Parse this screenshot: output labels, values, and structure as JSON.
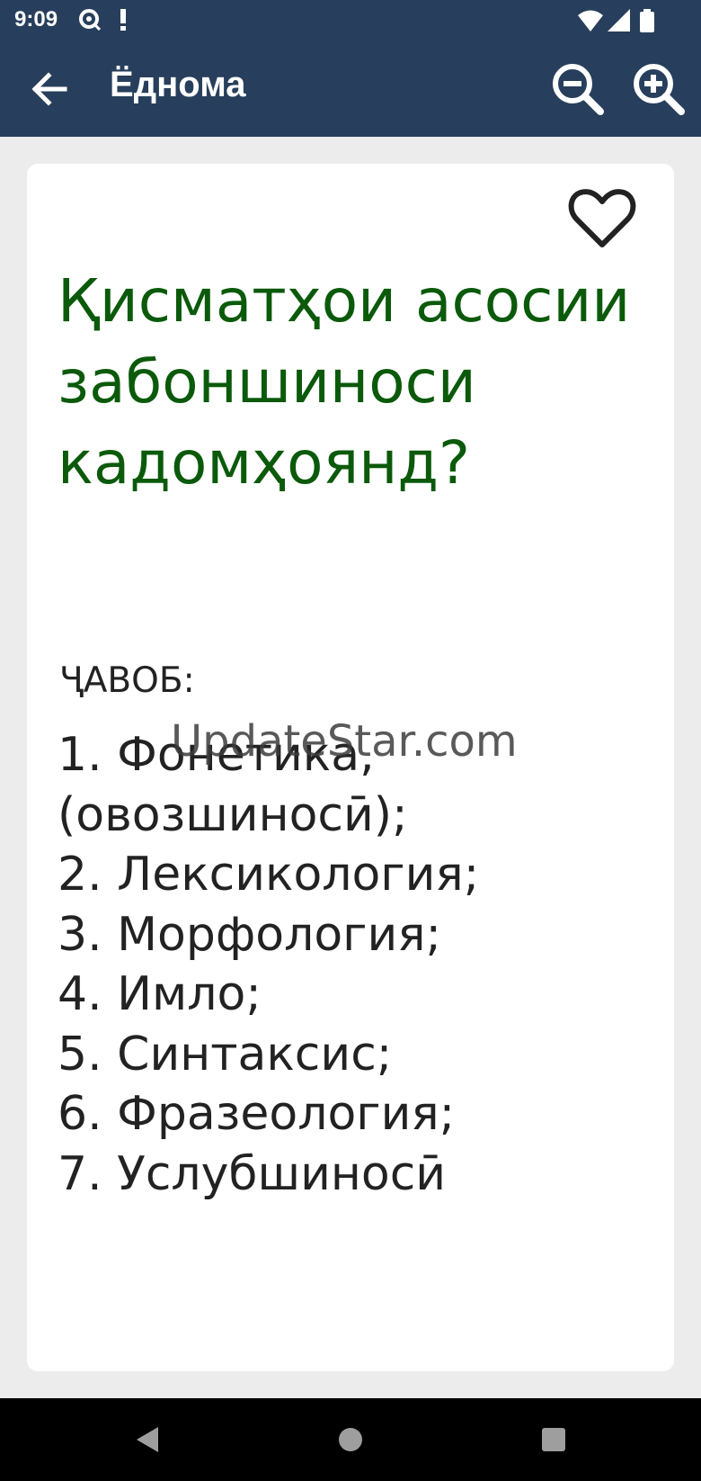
{
  "status_bar": {
    "time": "9:09",
    "notification_icons": [
      "sync-icon",
      "alert-icon"
    ],
    "system_icons": [
      "wifi-icon",
      "signal-icon",
      "battery-icon"
    ]
  },
  "app_bar": {
    "title": "Ёднома",
    "back_icon": "arrow-left-icon",
    "zoom_out_icon": "zoom-out-icon",
    "zoom_in_icon": "zoom-in-icon"
  },
  "card": {
    "favorite_icon": "heart-outline-icon",
    "question": "Қисматҳои асосии забоншиноси кадомҳоянд?",
    "answer_label": "ҶАВОБ:",
    "answer_items": [
      "1. Фонетика,",
      "(овозшиносӣ);",
      "2. Лексикология;",
      "3. Морфология;",
      "4. Имло;",
      "5. Синтаксис;",
      "6. Фразеология;",
      "7. Услубшиносӣ"
    ]
  },
  "watermark": "UpdateStar.com",
  "nav_bar": {
    "icons": [
      "nav-back-icon",
      "nav-home-icon",
      "nav-recents-icon"
    ]
  },
  "colors": {
    "app_bar": "#273f5c",
    "question_text": "#0b5a0b",
    "body_text": "#222222",
    "background": "#ececec"
  }
}
